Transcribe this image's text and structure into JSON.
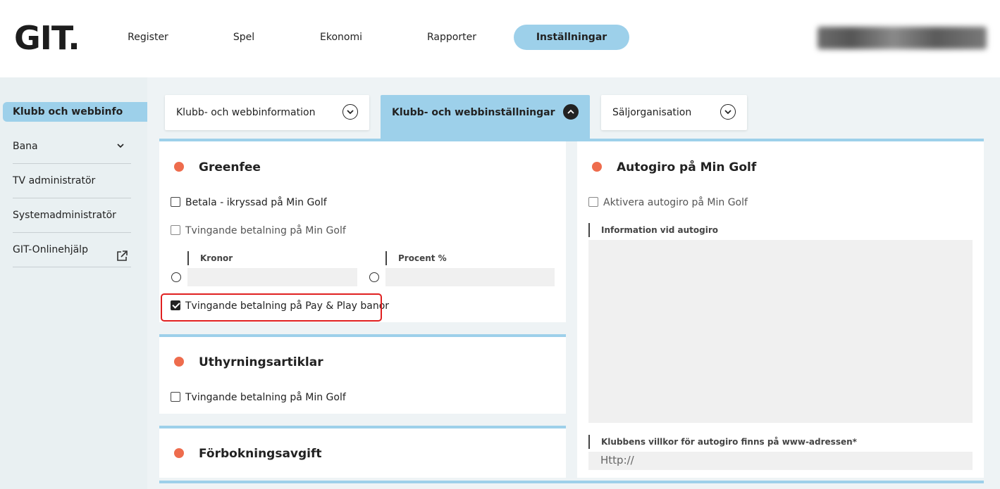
{
  "logo": "GIT.",
  "nav": {
    "items": [
      "Register",
      "Spel",
      "Ekonomi",
      "Rapporter",
      "Inställningar"
    ],
    "active": "Inställningar"
  },
  "sidebar": {
    "items": [
      {
        "label": "Klubb och webbinfo",
        "active": true
      },
      {
        "label": "Bana"
      },
      {
        "label": "TV administratör"
      },
      {
        "label": "Systemadministratör"
      },
      {
        "label": "GIT-Onlinehjälp"
      }
    ]
  },
  "tabs": [
    {
      "label": "Klubb- och webbinformation",
      "icon": "chevron-down-icon"
    },
    {
      "label": "Klubb- och webbinställningar",
      "icon": "chevron-up-icon",
      "active": true
    },
    {
      "label": "Säljorganisation",
      "icon": "chevron-down-icon"
    }
  ],
  "greenfee": {
    "title": "Greenfee",
    "pay_checked_label": "Betala - ikryssad på Min Golf",
    "force_min_golf_label": "Tvingande betalning på Min Golf",
    "kronor_label": "Kronor",
    "procent_label": "Procent %",
    "force_payplay_label": "Tvingande betalning på Pay & Play banor",
    "force_payplay_checked": true
  },
  "rental": {
    "title": "Uthyrningsartiklar",
    "force_min_golf_label": "Tvingande betalning på Min Golf"
  },
  "prebooking": {
    "title": "Förbokningsavgift"
  },
  "autogiro": {
    "title": "Autogiro på Min Golf",
    "activate_label": "Aktivera autogiro på Min Golf",
    "info_label": "Information vid autogiro",
    "terms_label": "Klubbens villkor för autogiro finns på www-adressen*",
    "url_placeholder": "Http://"
  },
  "colors": {
    "accent": "#9dd0ea",
    "dot": "#ee6c4d",
    "highlight": "#e02020"
  }
}
